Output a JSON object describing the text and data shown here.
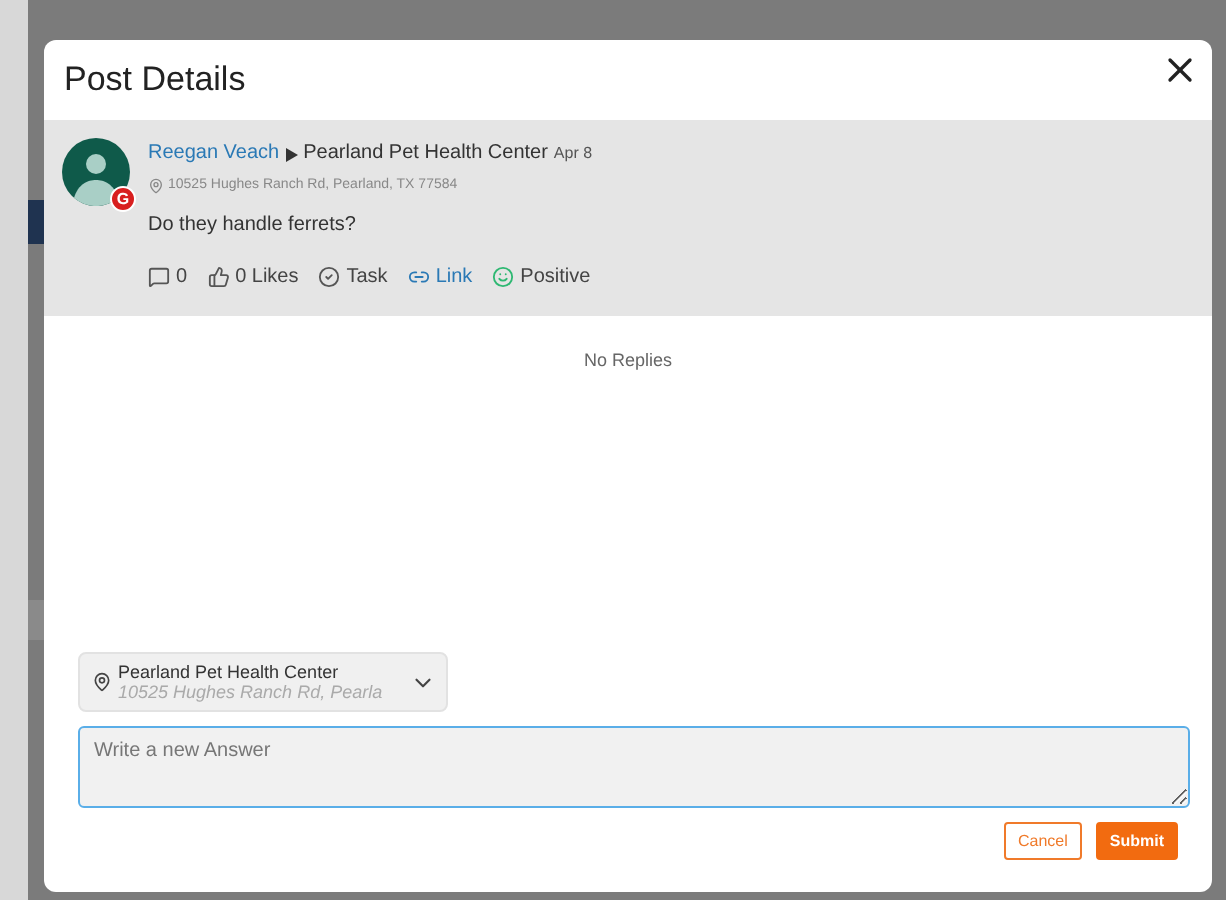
{
  "dialog": {
    "title": "Post Details"
  },
  "post": {
    "author": "Reegan Veach",
    "location": "Pearland Pet Health Center",
    "date": "Apr 8",
    "source_badge": "G",
    "address": "10525 Hughes Ranch Rd, Pearland, TX 77584",
    "text": "Do they handle ferrets?",
    "actions": [
      {
        "kind": "comments",
        "label": "0"
      },
      {
        "kind": "likes",
        "label": "0 Likes"
      },
      {
        "kind": "task",
        "label": "Task"
      },
      {
        "kind": "link",
        "label": "Link"
      },
      {
        "kind": "sentiment",
        "label": "Positive"
      }
    ]
  },
  "replies": {
    "empty_text": "No Replies"
  },
  "location_select": {
    "name": "Pearland Pet Health Center",
    "address": "10525 Hughes Ranch Rd, Pearla"
  },
  "answer": {
    "placeholder": "Write a new Answer"
  },
  "buttons": [
    {
      "kind": "secondary",
      "label": "Cancel"
    },
    {
      "kind": "primary",
      "label": "Submit"
    }
  ]
}
